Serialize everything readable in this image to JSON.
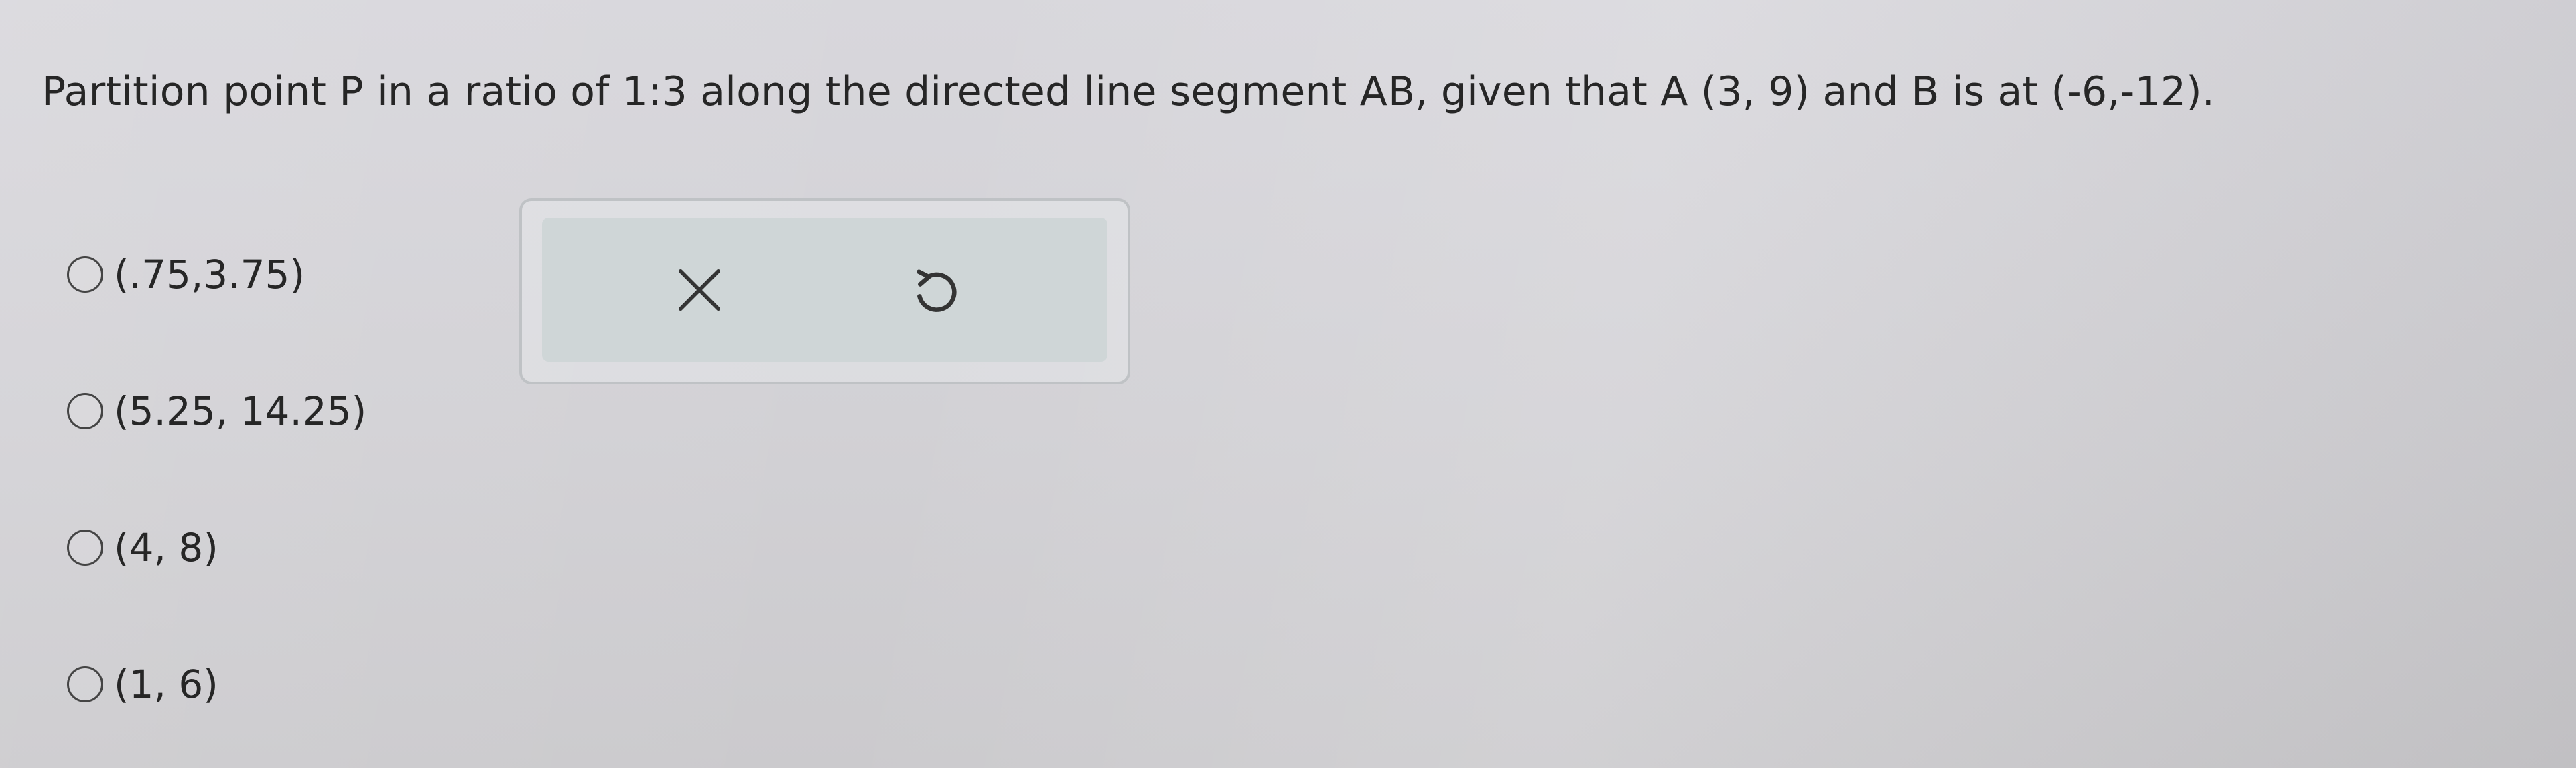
{
  "question": {
    "text": "Partition point P in a ratio of 1:3  along the directed line segment AB, given that A (3, 9) and B is at (-6,-12)."
  },
  "options": [
    {
      "label": "(.75,3.75)"
    },
    {
      "label": "(5.25, 14.25)"
    },
    {
      "label": "(4, 8)"
    },
    {
      "label": "(1, 6)"
    }
  ],
  "toolbar": {
    "close_icon": "close-icon",
    "undo_icon": "undo-icon"
  }
}
